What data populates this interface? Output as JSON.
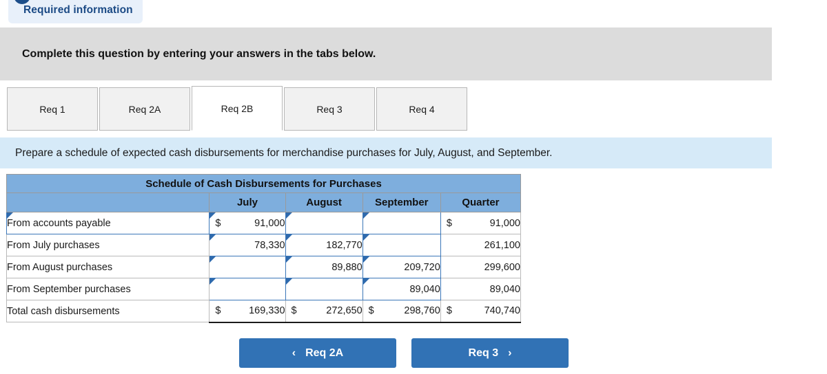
{
  "banner": {
    "info_icon": "info-circle-icon",
    "required_label": "Required information",
    "instruction": "Complete this question by entering your answers in the tabs below."
  },
  "tabs": [
    {
      "label": "Req 1",
      "active": false
    },
    {
      "label": "Req 2A",
      "active": false
    },
    {
      "label": "Req 2B",
      "active": true
    },
    {
      "label": "Req 3",
      "active": false
    },
    {
      "label": "Req 4",
      "active": false
    }
  ],
  "prompt": "Prepare a schedule of expected cash disbursements for merchandise purchases for July, August, and September.",
  "table": {
    "title": "Schedule of Cash Disbursements for Purchases",
    "columns": [
      "",
      "July",
      "August",
      "September",
      "Quarter"
    ],
    "rows": [
      {
        "label": "From accounts payable",
        "label_editable": true,
        "july": "91,000",
        "july_symbol": "$",
        "july_editable": true,
        "august": "",
        "august_symbol": "",
        "august_editable": true,
        "september": "",
        "september_symbol": "",
        "september_editable": true,
        "quarter": "91,000",
        "quarter_symbol": "$"
      },
      {
        "label": "From July purchases",
        "label_editable": false,
        "july": "78,330",
        "july_symbol": "",
        "july_editable": true,
        "august": "182,770",
        "august_symbol": "",
        "august_editable": true,
        "september": "",
        "september_symbol": "",
        "september_editable": true,
        "quarter": "261,100",
        "quarter_symbol": ""
      },
      {
        "label": "From August purchases",
        "label_editable": false,
        "july": "",
        "july_symbol": "",
        "july_editable": true,
        "august": "89,880",
        "august_symbol": "",
        "august_editable": true,
        "september": "209,720",
        "september_symbol": "",
        "september_editable": true,
        "quarter": "299,600",
        "quarter_symbol": ""
      },
      {
        "label": "From September purchases",
        "label_editable": false,
        "july": "",
        "july_symbol": "",
        "july_editable": true,
        "august": "",
        "august_symbol": "",
        "august_editable": true,
        "september": "89,040",
        "september_symbol": "",
        "september_editable": true,
        "quarter": "89,040",
        "quarter_symbol": ""
      }
    ],
    "total": {
      "label": "Total cash disbursements",
      "july": "169,330",
      "july_symbol": "$",
      "august": "272,650",
      "august_symbol": "$",
      "september": "298,760",
      "september_symbol": "$",
      "quarter": "740,740",
      "quarter_symbol": "$"
    }
  },
  "nav": {
    "prev_label": "Req 2A",
    "prev_icon": "chevron-left-icon",
    "next_label": "Req 3",
    "next_icon": "chevron-right-icon"
  },
  "colors": {
    "accent_blue": "#3172b5",
    "table_header_blue": "#7eaedd",
    "prompt_blue": "#d6eaf8",
    "banner_gray": "#dcdcdc",
    "pill_blue": "#e8f0fa",
    "input_border": "#3a76b8"
  }
}
